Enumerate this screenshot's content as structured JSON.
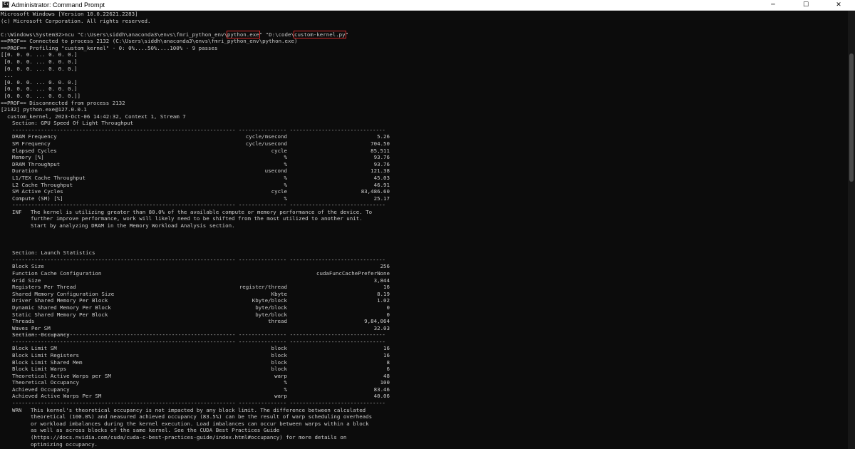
{
  "window": {
    "title": "Administrator: Command Prompt",
    "icon_label": "C:\\",
    "min_symbol": "─",
    "max_symbol": "☐",
    "close_symbol": "✕"
  },
  "header_lines": [
    "Microsoft Windows [Version 10.0.22621.2283]",
    "(c) Microsoft Corporation. All rights reserved."
  ],
  "command": {
    "prompt": "C:\\Windows\\System32>ncu \"C:\\Users\\siddh\\anaconda3\\envs\\fmri_python_env\\",
    "exe_highlight": "python.exe",
    "middle": "\" \"D:\\code\\",
    "script_highlight": "custom-kernel.py",
    "end": "\""
  },
  "output_lines": [
    "==PROF== Connected to process 2132 (C:\\Users\\siddh\\anaconda3\\envs\\fmri_python_env\\python.exe)",
    "==PROF== Profiling \"custom_kernel\" - 0: 0%....50%....100% - 9 passes",
    "[[0. 0. 0. ... 0. 0. 0.]",
    " [0. 0. 0. ... 0. 0. 0.]",
    " [0. 0. 0. ... 0. 0. 0.]",
    " ...",
    " [0. 0. 0. ... 0. 0. 0.]",
    " [0. 0. 0. ... 0. 0. 0.]",
    " [0. 0. 0. ... 0. 0. 0.]]",
    "==PROF== Disconnected from process 2132",
    "[2132] python.exe@127.0.0.1",
    "  custom_kernel, 2023-Oct-06 14:42:32, Context 1, Stream 7"
  ],
  "separator_text": "---------------------------------------------------------------------- --------------- ------------------------------",
  "sections": [
    {
      "title": "Section: GPU Speed Of Light Throughput",
      "rows": [
        [
          "DRAM Frequency",
          "cycle/msecond",
          "5.26"
        ],
        [
          "SM Frequency",
          "cycle/usecond",
          "704.50"
        ],
        [
          "Elapsed Cycles",
          "cycle",
          "85,511"
        ],
        [
          "Memory [%]",
          "%",
          "93.76"
        ],
        [
          "DRAM Throughput",
          "%",
          "93.76"
        ],
        [
          "Duration",
          "usecond",
          "121.38"
        ],
        [
          "L1/TEX Cache Throughput",
          "%",
          "45.03"
        ],
        [
          "L2 Cache Throughput",
          "%",
          "46.91"
        ],
        [
          "SM Active Cycles",
          "cycle",
          "83,486.60"
        ],
        [
          "Compute (SM) [%]",
          "%",
          "25.17"
        ]
      ],
      "note": {
        "tag": "INF",
        "lines": [
          "The kernel is utilizing greater than 80.0% of the available compute or memory performance of the device. To",
          "further improve performance, work will likely need to be shifted from the most utilized to another unit.",
          "Start by analyzing DRAM in the Memory Workload Analysis section."
        ]
      }
    },
    {
      "title": "Section: Launch Statistics",
      "rows": [
        [
          "Block Size",
          "",
          "256"
        ],
        [
          "Function Cache Configuration",
          "",
          "cudaFuncCachePreferNone"
        ],
        [
          "Grid Size",
          "",
          "3,844"
        ],
        [
          "Registers Per Thread",
          "register/thread",
          "16"
        ],
        [
          "Shared Memory Configuration Size",
          "Kbyte",
          "8.19"
        ],
        [
          "Driver Shared Memory Per Block",
          "Kbyte/block",
          "1.02"
        ],
        [
          "Dynamic Shared Memory Per Block",
          "byte/block",
          "0"
        ],
        [
          "Static Shared Memory Per Block",
          "byte/block",
          "0"
        ],
        [
          "Threads",
          "thread",
          "9,84,064"
        ],
        [
          "Waves Per SM",
          "",
          "32.03"
        ]
      ]
    },
    {
      "title": "Section: Occupancy",
      "rows": [
        [
          "Block Limit SM",
          "block",
          "16"
        ],
        [
          "Block Limit Registers",
          "block",
          "16"
        ],
        [
          "Block Limit Shared Mem",
          "block",
          "8"
        ],
        [
          "Block Limit Warps",
          "block",
          "6"
        ],
        [
          "Theoretical Active Warps per SM",
          "warp",
          "48"
        ],
        [
          "Theoretical Occupancy",
          "%",
          "100"
        ],
        [
          "Achieved Occupancy",
          "%",
          "83.46"
        ],
        [
          "Achieved Active Warps Per SM",
          "warp",
          "40.06"
        ]
      ],
      "note": {
        "tag": "WRN",
        "lines": [
          "This kernel's theoretical occupancy is not impacted by any block limit. The difference between calculated",
          "theoretical (100.0%) and measured achieved occupancy (83.5%) can be the result of warp scheduling overheads",
          "or workload imbalances during the kernel execution. Load imbalances can occur between warps within a block",
          "as well as across blocks of the same kernel. See the CUDA Best Practices Guide",
          "(https://docs.nvidia.com/cuda/cuda-c-best-practices-guide/index.html#occupancy) for more details on",
          "optimizing occupancy."
        ]
      }
    }
  ],
  "colors": {
    "console_bg": "#0c0c0c",
    "console_text": "#cccccc",
    "highlight_box": "#d42a2a"
  }
}
